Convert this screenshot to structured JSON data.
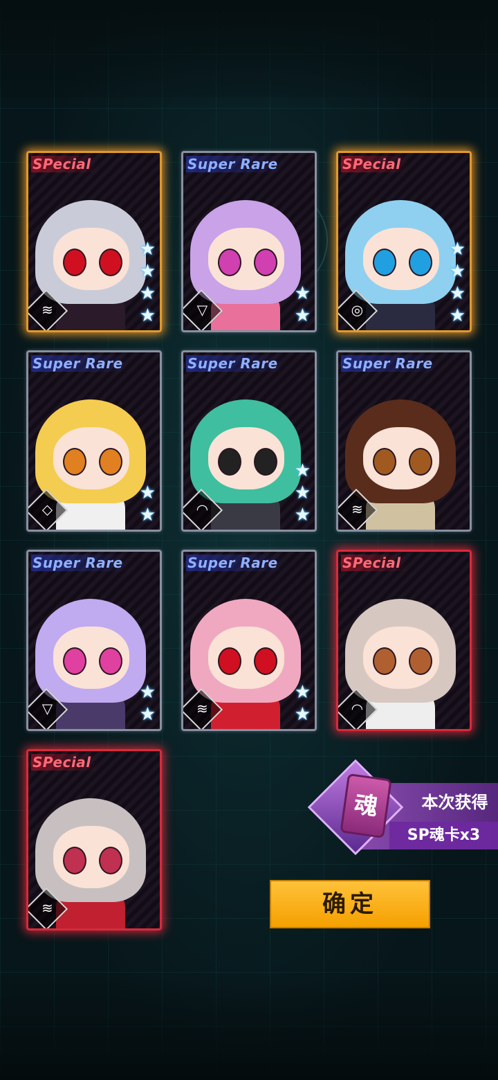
{
  "cards": [
    {
      "rarity": "SPecial",
      "rarity_type": "special",
      "frame": "sp-gold",
      "stars": 4,
      "class_icon": "tank-class-icon",
      "hair": "#c9ccd8",
      "eye": "#d01020",
      "body": "#2a1a2a"
    },
    {
      "rarity": "Super Rare",
      "rarity_type": "super",
      "frame": "sr",
      "stars": 2,
      "class_icon": "attack-class-icon",
      "hair": "#c9a2e8",
      "eye": "#d040b0",
      "body": "#e8709a"
    },
    {
      "rarity": "SPecial",
      "rarity_type": "special",
      "frame": "sp-gold",
      "stars": 4,
      "class_icon": "support-class-icon",
      "hair": "#8fd0f0",
      "eye": "#20a0e0",
      "body": "#2a2a40"
    },
    {
      "rarity": "Super Rare",
      "rarity_type": "super",
      "frame": "sr",
      "stars": 2,
      "class_icon": "defense-class-icon",
      "hair": "#f4cc50",
      "eye": "#e08020",
      "body": "#f0f0f0"
    },
    {
      "rarity": "Super Rare",
      "rarity_type": "super",
      "frame": "sr",
      "stars": 3,
      "class_icon": "signal-class-icon",
      "hair": "#3fbf9f",
      "eye": "#222222",
      "body": "#3a3a44"
    },
    {
      "rarity": "Super Rare",
      "rarity_type": "super",
      "frame": "sr",
      "stars": 0,
      "class_icon": "tank-class-icon",
      "hair": "#5a2c1c",
      "eye": "#a05a20",
      "body": "#d0c2a0"
    },
    {
      "rarity": "Super Rare",
      "rarity_type": "super",
      "frame": "sr",
      "stars": 2,
      "class_icon": "attack-class-icon",
      "hair": "#c0aaf0",
      "eye": "#e040a0",
      "body": "#4a3a6a"
    },
    {
      "rarity": "Super Rare",
      "rarity_type": "super",
      "frame": "sr",
      "stars": 2,
      "class_icon": "tank-class-icon",
      "hair": "#f0a8c0",
      "eye": "#d01020",
      "body": "#d02030"
    },
    {
      "rarity": "SPecial",
      "rarity_type": "special",
      "frame": "sp-red",
      "stars": 0,
      "class_icon": "signal-class-icon",
      "hair": "#d6c8c0",
      "eye": "#b06030",
      "body": "#eeeeee"
    },
    {
      "rarity": "SPecial",
      "rarity_type": "special",
      "frame": "sp-red",
      "stars": 0,
      "class_icon": "tank-class-icon",
      "hair": "#c8c0c0",
      "eye": "#c03050",
      "body": "#c02030"
    }
  ],
  "reward": {
    "soul_glyph": "魂",
    "line1": "本次获得",
    "line2": "SP魂卡x3"
  },
  "confirm_label": "确定"
}
